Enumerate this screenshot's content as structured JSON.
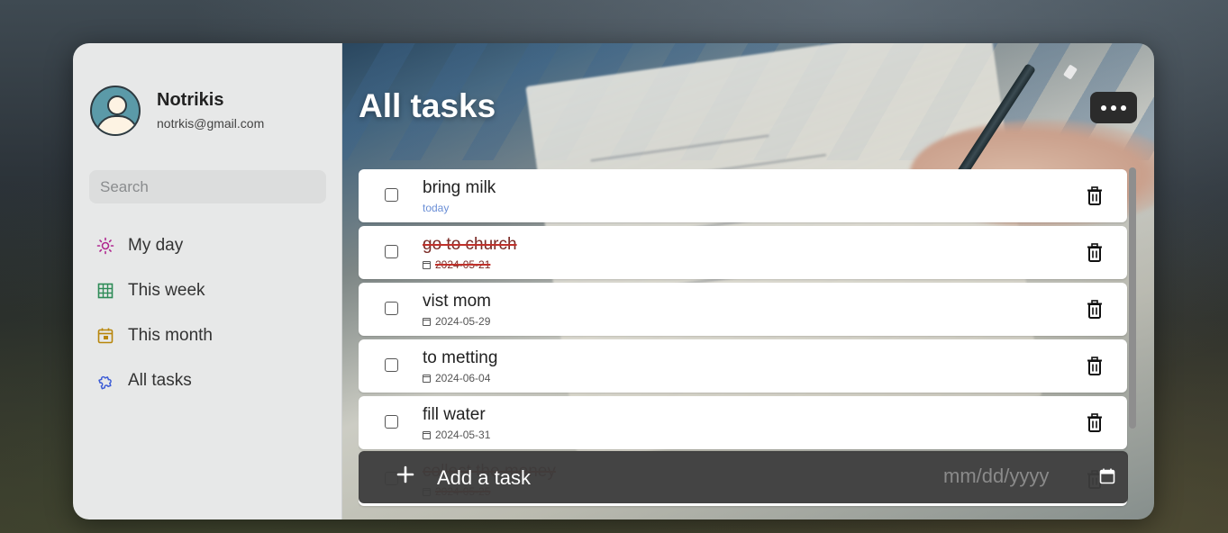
{
  "user": {
    "name": "Notrikis",
    "email": "notrkis@gmail.com"
  },
  "search": {
    "placeholder": "Search"
  },
  "nav": {
    "items": [
      {
        "label": "My day",
        "icon": "sun-icon",
        "color": "#b0278f"
      },
      {
        "label": "This week",
        "icon": "grid-icon",
        "color": "#2e8b57"
      },
      {
        "label": "This month",
        "icon": "calendar-icon",
        "color": "#b8860b"
      },
      {
        "label": "All tasks",
        "icon": "puzzle-icon",
        "color": "#3b5bd6"
      }
    ]
  },
  "main": {
    "title": "All tasks",
    "tasks": [
      {
        "text": "bring milk",
        "date": "today",
        "done": false
      },
      {
        "text": "go to church",
        "date": "2024-05-21",
        "done": true
      },
      {
        "text": "vist mom",
        "date": "2024-05-29",
        "done": false
      },
      {
        "text": "to metting",
        "date": "2024-06-04",
        "done": false
      },
      {
        "text": "fill water",
        "date": "2024-05-31",
        "done": false
      },
      {
        "text": "collect the money",
        "date": "2024-05-25",
        "done": true
      }
    ],
    "add_task": {
      "placeholder": "Add a task",
      "date_placeholder": "mm/dd/yyyy"
    }
  },
  "colors": {
    "done_strike": "#c0312b",
    "today_date": "#6b8fd6",
    "add_bar": "#3c3c3c"
  }
}
